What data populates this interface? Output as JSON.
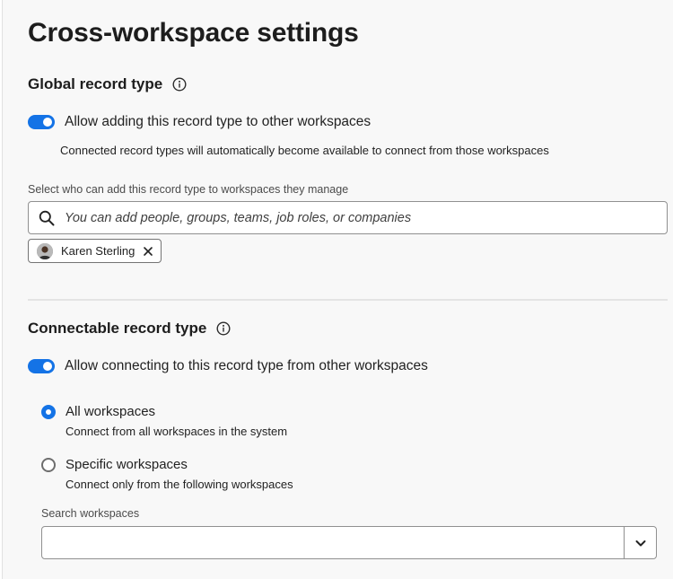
{
  "page": {
    "title": "Cross-workspace settings"
  },
  "global_section": {
    "title": "Global record type",
    "toggle_label": "Allow adding this record type to other workspaces",
    "toggle_on": true,
    "helper_text": "Connected record types will automatically become available to connect from those workspaces",
    "select_label": "Select who can add this record type to workspaces they manage",
    "search_placeholder": "You can add people, groups, teams, job roles, or companies",
    "selected_chips": [
      {
        "label": "Karen Sterling"
      }
    ]
  },
  "connectable_section": {
    "title": "Connectable record type",
    "toggle_label": "Allow connecting to this record type from other workspaces",
    "toggle_on": true,
    "options": [
      {
        "label": "All workspaces",
        "description": "Connect from all workspaces in the system",
        "selected": true
      },
      {
        "label": "Specific workspaces",
        "description": "Connect only from the following workspaces",
        "selected": false
      }
    ],
    "search_label": "Search workspaces",
    "search_value": ""
  },
  "icons": {
    "info": "info-icon",
    "search": "search-icon",
    "remove": "close-icon",
    "dropdown": "chevron-down-icon"
  },
  "colors": {
    "accent": "#1473e6",
    "background": "#f8f8f8",
    "border": "#909090"
  }
}
